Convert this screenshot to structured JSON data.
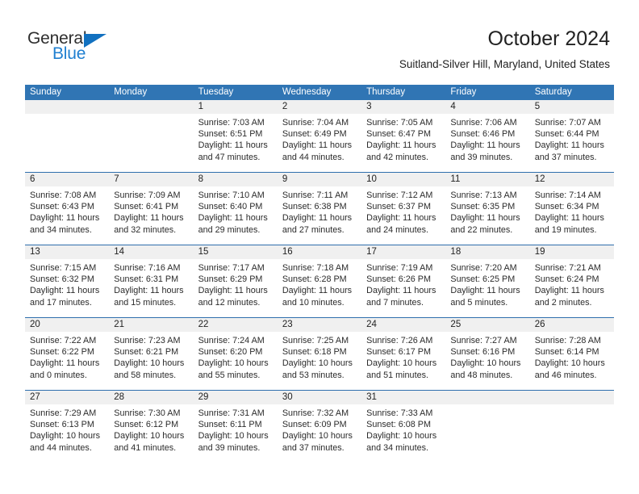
{
  "brand": {
    "name_part1": "General",
    "name_part2": "Blue",
    "triangle_color": "#1271c0",
    "blue_color": "#1f7fd0"
  },
  "header": {
    "title": "October 2024",
    "subtitle": "Suitland-Silver Hill, Maryland, United States",
    "accent_color": "#3075b4"
  },
  "calendar": {
    "weekdays": [
      "Sunday",
      "Monday",
      "Tuesday",
      "Wednesday",
      "Thursday",
      "Friday",
      "Saturday"
    ],
    "weeks": [
      [
        {
          "day": "",
          "lines": []
        },
        {
          "day": "",
          "lines": []
        },
        {
          "day": "1",
          "lines": [
            "Sunrise: 7:03 AM",
            "Sunset: 6:51 PM",
            "Daylight: 11 hours",
            "and 47 minutes."
          ]
        },
        {
          "day": "2",
          "lines": [
            "Sunrise: 7:04 AM",
            "Sunset: 6:49 PM",
            "Daylight: 11 hours",
            "and 44 minutes."
          ]
        },
        {
          "day": "3",
          "lines": [
            "Sunrise: 7:05 AM",
            "Sunset: 6:47 PM",
            "Daylight: 11 hours",
            "and 42 minutes."
          ]
        },
        {
          "day": "4",
          "lines": [
            "Sunrise: 7:06 AM",
            "Sunset: 6:46 PM",
            "Daylight: 11 hours",
            "and 39 minutes."
          ]
        },
        {
          "day": "5",
          "lines": [
            "Sunrise: 7:07 AM",
            "Sunset: 6:44 PM",
            "Daylight: 11 hours",
            "and 37 minutes."
          ]
        }
      ],
      [
        {
          "day": "6",
          "lines": [
            "Sunrise: 7:08 AM",
            "Sunset: 6:43 PM",
            "Daylight: 11 hours",
            "and 34 minutes."
          ]
        },
        {
          "day": "7",
          "lines": [
            "Sunrise: 7:09 AM",
            "Sunset: 6:41 PM",
            "Daylight: 11 hours",
            "and 32 minutes."
          ]
        },
        {
          "day": "8",
          "lines": [
            "Sunrise: 7:10 AM",
            "Sunset: 6:40 PM",
            "Daylight: 11 hours",
            "and 29 minutes."
          ]
        },
        {
          "day": "9",
          "lines": [
            "Sunrise: 7:11 AM",
            "Sunset: 6:38 PM",
            "Daylight: 11 hours",
            "and 27 minutes."
          ]
        },
        {
          "day": "10",
          "lines": [
            "Sunrise: 7:12 AM",
            "Sunset: 6:37 PM",
            "Daylight: 11 hours",
            "and 24 minutes."
          ]
        },
        {
          "day": "11",
          "lines": [
            "Sunrise: 7:13 AM",
            "Sunset: 6:35 PM",
            "Daylight: 11 hours",
            "and 22 minutes."
          ]
        },
        {
          "day": "12",
          "lines": [
            "Sunrise: 7:14 AM",
            "Sunset: 6:34 PM",
            "Daylight: 11 hours",
            "and 19 minutes."
          ]
        }
      ],
      [
        {
          "day": "13",
          "lines": [
            "Sunrise: 7:15 AM",
            "Sunset: 6:32 PM",
            "Daylight: 11 hours",
            "and 17 minutes."
          ]
        },
        {
          "day": "14",
          "lines": [
            "Sunrise: 7:16 AM",
            "Sunset: 6:31 PM",
            "Daylight: 11 hours",
            "and 15 minutes."
          ]
        },
        {
          "day": "15",
          "lines": [
            "Sunrise: 7:17 AM",
            "Sunset: 6:29 PM",
            "Daylight: 11 hours",
            "and 12 minutes."
          ]
        },
        {
          "day": "16",
          "lines": [
            "Sunrise: 7:18 AM",
            "Sunset: 6:28 PM",
            "Daylight: 11 hours",
            "and 10 minutes."
          ]
        },
        {
          "day": "17",
          "lines": [
            "Sunrise: 7:19 AM",
            "Sunset: 6:26 PM",
            "Daylight: 11 hours",
            "and 7 minutes."
          ]
        },
        {
          "day": "18",
          "lines": [
            "Sunrise: 7:20 AM",
            "Sunset: 6:25 PM",
            "Daylight: 11 hours",
            "and 5 minutes."
          ]
        },
        {
          "day": "19",
          "lines": [
            "Sunrise: 7:21 AM",
            "Sunset: 6:24 PM",
            "Daylight: 11 hours",
            "and 2 minutes."
          ]
        }
      ],
      [
        {
          "day": "20",
          "lines": [
            "Sunrise: 7:22 AM",
            "Sunset: 6:22 PM",
            "Daylight: 11 hours",
            "and 0 minutes."
          ]
        },
        {
          "day": "21",
          "lines": [
            "Sunrise: 7:23 AM",
            "Sunset: 6:21 PM",
            "Daylight: 10 hours",
            "and 58 minutes."
          ]
        },
        {
          "day": "22",
          "lines": [
            "Sunrise: 7:24 AM",
            "Sunset: 6:20 PM",
            "Daylight: 10 hours",
            "and 55 minutes."
          ]
        },
        {
          "day": "23",
          "lines": [
            "Sunrise: 7:25 AM",
            "Sunset: 6:18 PM",
            "Daylight: 10 hours",
            "and 53 minutes."
          ]
        },
        {
          "day": "24",
          "lines": [
            "Sunrise: 7:26 AM",
            "Sunset: 6:17 PM",
            "Daylight: 10 hours",
            "and 51 minutes."
          ]
        },
        {
          "day": "25",
          "lines": [
            "Sunrise: 7:27 AM",
            "Sunset: 6:16 PM",
            "Daylight: 10 hours",
            "and 48 minutes."
          ]
        },
        {
          "day": "26",
          "lines": [
            "Sunrise: 7:28 AM",
            "Sunset: 6:14 PM",
            "Daylight: 10 hours",
            "and 46 minutes."
          ]
        }
      ],
      [
        {
          "day": "27",
          "lines": [
            "Sunrise: 7:29 AM",
            "Sunset: 6:13 PM",
            "Daylight: 10 hours",
            "and 44 minutes."
          ]
        },
        {
          "day": "28",
          "lines": [
            "Sunrise: 7:30 AM",
            "Sunset: 6:12 PM",
            "Daylight: 10 hours",
            "and 41 minutes."
          ]
        },
        {
          "day": "29",
          "lines": [
            "Sunrise: 7:31 AM",
            "Sunset: 6:11 PM",
            "Daylight: 10 hours",
            "and 39 minutes."
          ]
        },
        {
          "day": "30",
          "lines": [
            "Sunrise: 7:32 AM",
            "Sunset: 6:09 PM",
            "Daylight: 10 hours",
            "and 37 minutes."
          ]
        },
        {
          "day": "31",
          "lines": [
            "Sunrise: 7:33 AM",
            "Sunset: 6:08 PM",
            "Daylight: 10 hours",
            "and 34 minutes."
          ]
        },
        {
          "day": "",
          "lines": []
        },
        {
          "day": "",
          "lines": []
        }
      ]
    ]
  }
}
